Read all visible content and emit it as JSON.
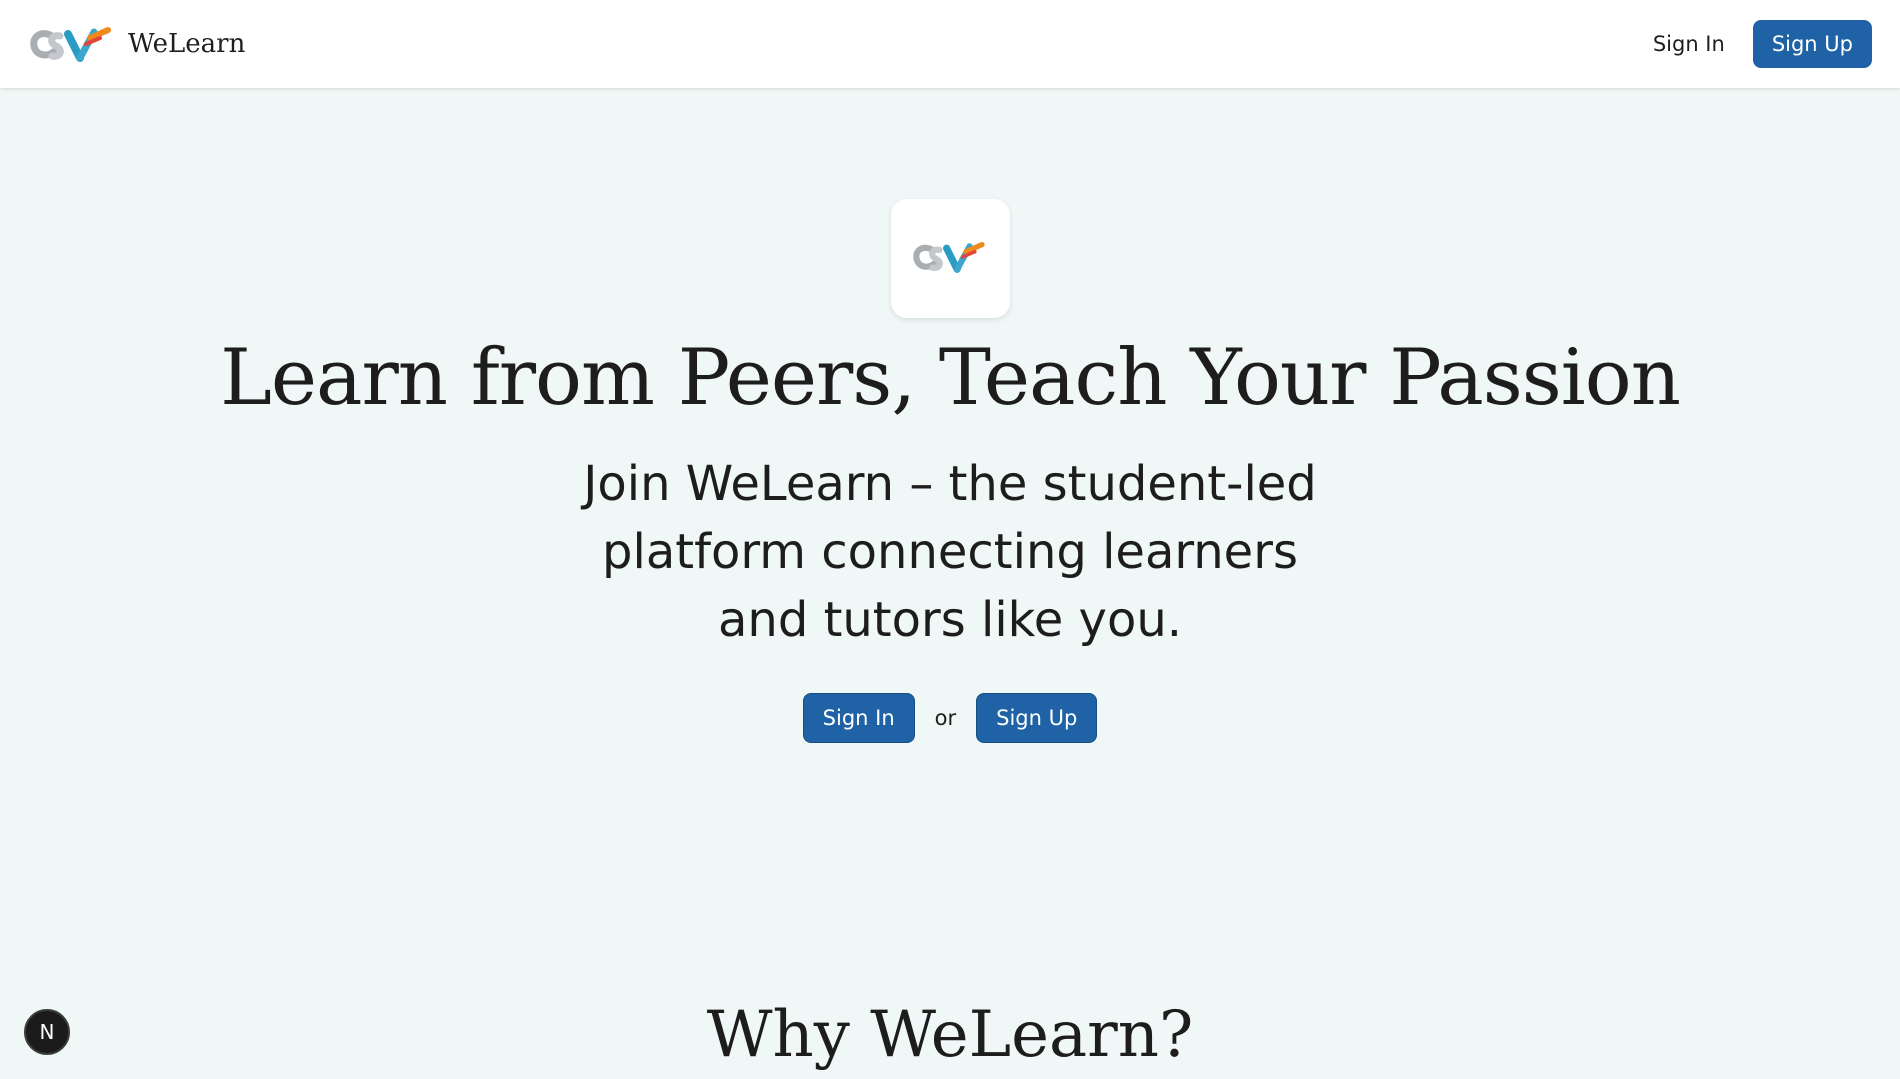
{
  "header": {
    "brand_name": "WeLearn",
    "sign_in_label": "Sign In",
    "sign_up_label": "Sign Up"
  },
  "hero": {
    "title": "Learn from Peers, Teach Your Passion",
    "subtitle": "Join WeLearn – the student-led platform connecting learners and tutors like you.",
    "sign_in_label": "Sign In",
    "or_text": "or",
    "sign_up_label": "Sign Up"
  },
  "section": {
    "why_heading": "Why WeLearn?"
  },
  "dev_badge": {
    "letter": "N"
  },
  "colors": {
    "background": "#eff8f6",
    "primary_button": "#1f63a6",
    "header_bg": "#ffffff",
    "logo_gray": "#a9aeb3",
    "logo_blue": "#2a9bc4",
    "logo_orange": "#f08a1c",
    "logo_red": "#e2453c"
  },
  "icons": {
    "brand_logo": "welearn-logo-icon",
    "dev_indicator": "nextjs-dev-indicator-icon"
  }
}
